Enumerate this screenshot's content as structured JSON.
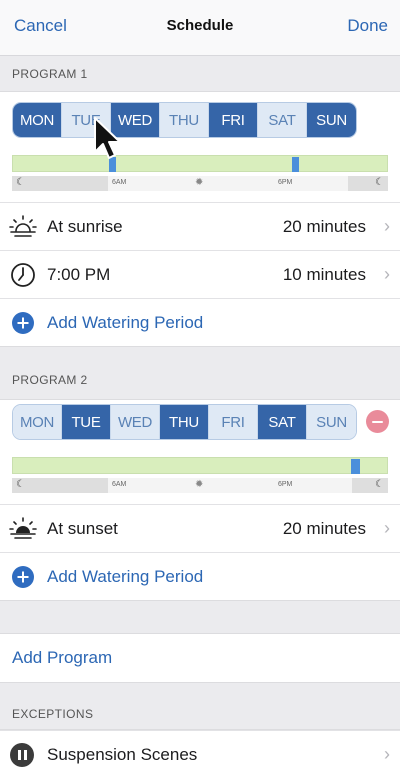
{
  "navbar": {
    "cancel_label": "Cancel",
    "title": "Schedule",
    "done_label": "Done"
  },
  "program1": {
    "header": "PROGRAM 1",
    "days": [
      {
        "label": "MON",
        "active": true
      },
      {
        "label": "TUE",
        "active": false
      },
      {
        "label": "WED",
        "active": true
      },
      {
        "label": "THU",
        "active": false
      },
      {
        "label": "FRI",
        "active": true
      },
      {
        "label": "SAT",
        "active": false
      },
      {
        "label": "SUN",
        "active": true
      }
    ],
    "timeline": {
      "label_6am": "6AM",
      "label_6pm": "6PM"
    },
    "periods": [
      {
        "icon": "sunrise-icon",
        "label": "At sunrise",
        "value": "20 minutes"
      },
      {
        "icon": "clock-icon",
        "label": "7:00 PM",
        "value": "10 minutes"
      }
    ],
    "add_period_label": "Add Watering Period"
  },
  "program2": {
    "header": "PROGRAM 2",
    "days": [
      {
        "label": "MON",
        "active": false
      },
      {
        "label": "TUE",
        "active": true
      },
      {
        "label": "WED",
        "active": false
      },
      {
        "label": "THU",
        "active": true
      },
      {
        "label": "FRI",
        "active": false
      },
      {
        "label": "SAT",
        "active": true
      },
      {
        "label": "SUN",
        "active": false
      }
    ],
    "timeline": {
      "label_6am": "6AM",
      "label_6pm": "6PM"
    },
    "periods": [
      {
        "icon": "sunset-icon",
        "label": "At sunset",
        "value": "20 minutes"
      }
    ],
    "add_period_label": "Add Watering Period"
  },
  "add_program_label": "Add Program",
  "exceptions": {
    "header": "EXCEPTIONS",
    "item_label": "Suspension Scenes"
  },
  "colors": {
    "accent": "#2f6cc0",
    "day_active": "#3565a8",
    "day_inactive": "#dfe9f5",
    "timeline_green": "#d9eebd",
    "remove": "#e98b9a"
  }
}
